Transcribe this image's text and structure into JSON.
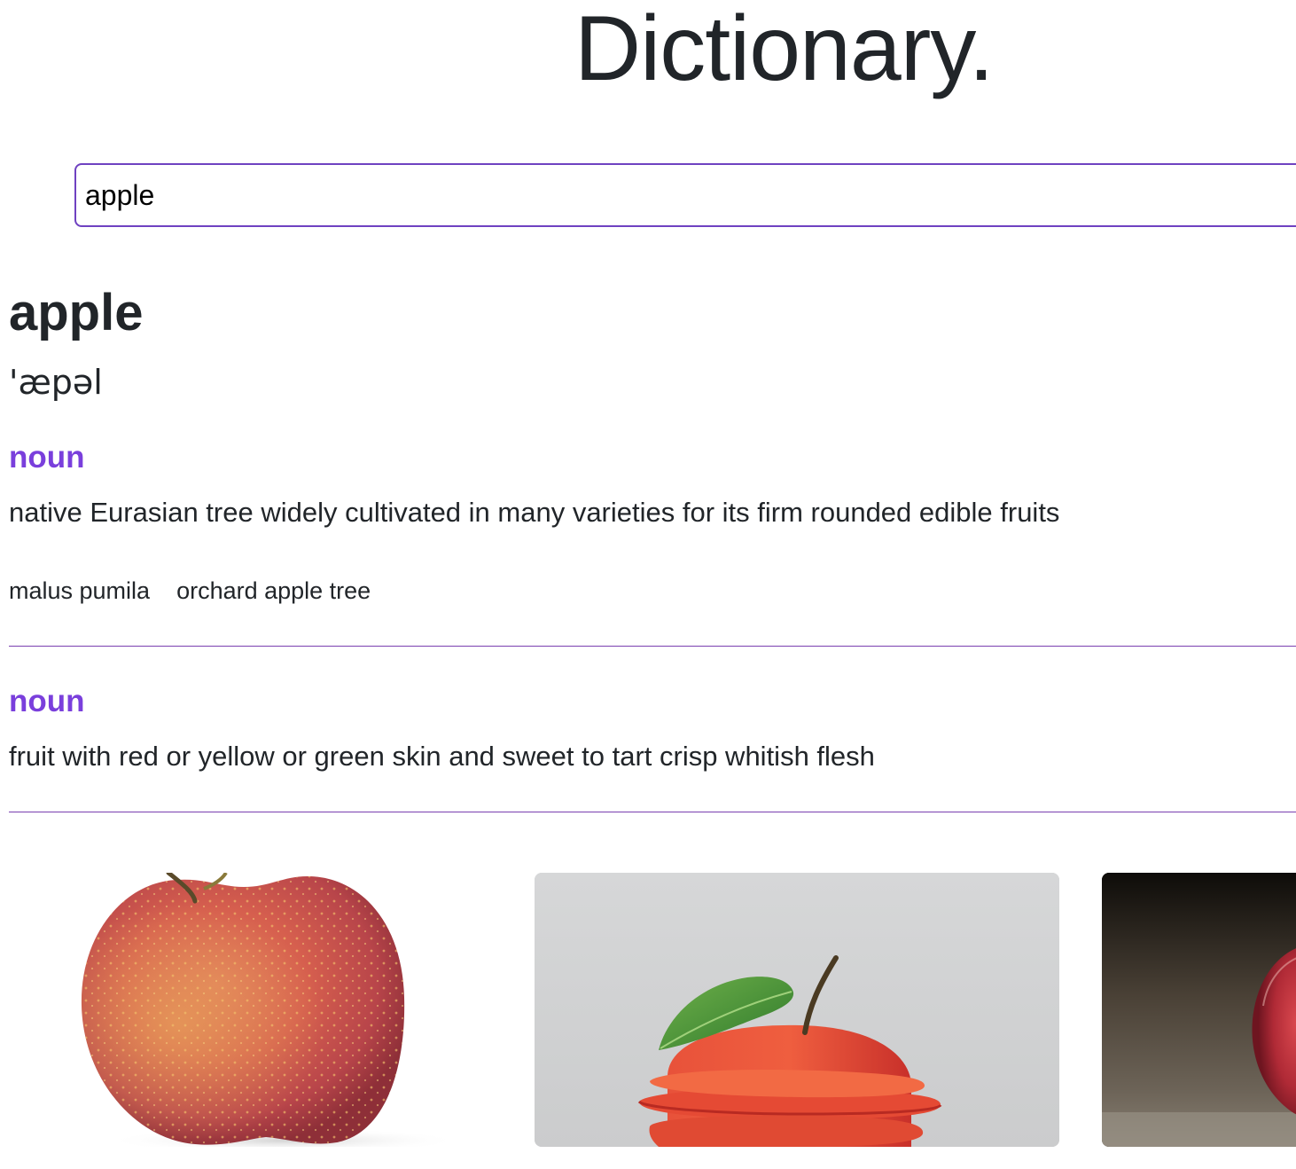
{
  "app": {
    "title": "Dictionary."
  },
  "search": {
    "value": "apple",
    "placeholder": ""
  },
  "entry": {
    "word": "apple",
    "phonetic": "'æpəl",
    "meanings": [
      {
        "part_of_speech": "noun",
        "definition": "native Eurasian tree widely cultivated in many varieties for its firm rounded edible fruits",
        "synonyms": [
          "malus pumila",
          "orchard apple tree"
        ]
      },
      {
        "part_of_speech": "noun",
        "definition": "fruit with red or yellow or green skin and sweet to tart crisp whitish flesh",
        "synonyms": []
      }
    ]
  },
  "colors": {
    "accent": "#7a3fdc",
    "input_border": "#6f42c1",
    "text": "#212529",
    "divider": "#7a3fb0"
  },
  "photos": [
    {
      "subject": "whole-red-apple"
    },
    {
      "subject": "sliced-apple-with-leaf"
    },
    {
      "subject": "red-apple-on-dark-background"
    }
  ]
}
